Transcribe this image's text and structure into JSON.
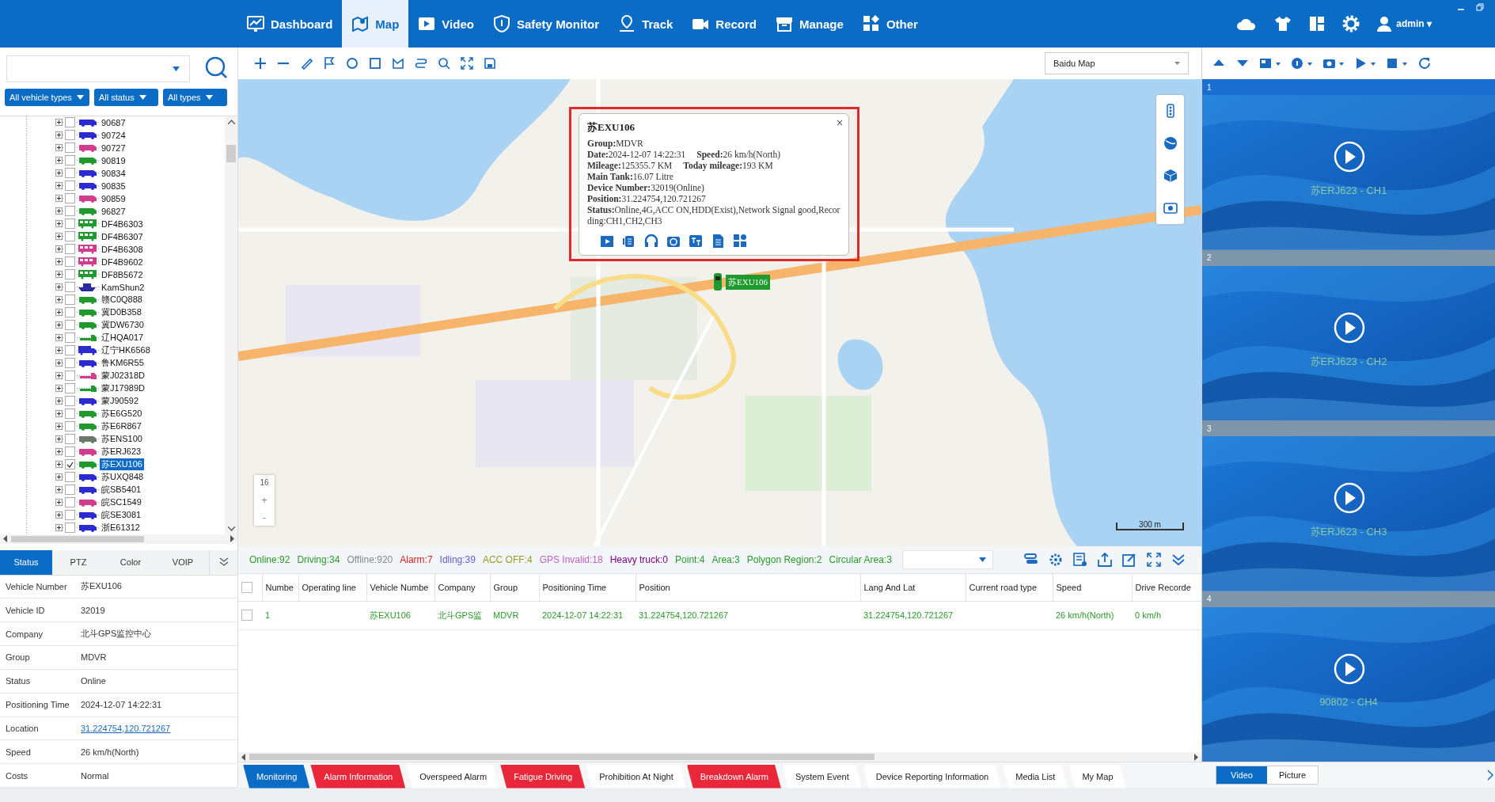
{
  "nav": {
    "items": [
      {
        "label": "Dashboard",
        "selected": false
      },
      {
        "label": "Map",
        "selected": true
      },
      {
        "label": "Video",
        "selected": false
      },
      {
        "label": "Safety Monitor",
        "selected": false
      },
      {
        "label": "Track",
        "selected": false
      },
      {
        "label": "Record",
        "selected": false
      },
      {
        "label": "Manage",
        "selected": false
      },
      {
        "label": "Other",
        "selected": false
      }
    ],
    "user": "admin ▾"
  },
  "vehicle_panel": {
    "filters": [
      "All vehicle types",
      "All status",
      "All types"
    ],
    "tree": [
      {
        "label": "90687",
        "kind": "car",
        "color": "#2b2bd0",
        "checked": false,
        "selected": false
      },
      {
        "label": "90724",
        "kind": "car",
        "color": "#2b2bd0",
        "checked": false,
        "selected": false
      },
      {
        "label": "90727",
        "kind": "car",
        "color": "#d23c8c",
        "checked": false,
        "selected": false
      },
      {
        "label": "90819",
        "kind": "car",
        "color": "#1e9a2e",
        "checked": false,
        "selected": false
      },
      {
        "label": "90834",
        "kind": "car",
        "color": "#2b2bd0",
        "checked": false,
        "selected": false
      },
      {
        "label": "90835",
        "kind": "car",
        "color": "#2b2bd0",
        "checked": false,
        "selected": false
      },
      {
        "label": "90859",
        "kind": "car",
        "color": "#d23c8c",
        "checked": false,
        "selected": false
      },
      {
        "label": "96827",
        "kind": "car",
        "color": "#1e9a2e",
        "checked": false,
        "selected": false
      },
      {
        "label": "DF4B6303",
        "kind": "bus",
        "color": "#1e9a2e",
        "checked": false,
        "selected": false
      },
      {
        "label": "DF4B6307",
        "kind": "bus",
        "color": "#1e9a2e",
        "checked": false,
        "selected": false
      },
      {
        "label": "DF4B6308",
        "kind": "bus",
        "color": "#d23c8c",
        "checked": false,
        "selected": false
      },
      {
        "label": "DF4B9602",
        "kind": "bus",
        "color": "#d23c8c",
        "checked": false,
        "selected": false
      },
      {
        "label": "DF8B5672",
        "kind": "bus",
        "color": "#1e9a2e",
        "checked": false,
        "selected": false
      },
      {
        "label": "KamShun2",
        "kind": "boat",
        "color": "#2a2aa0",
        "checked": false,
        "selected": false
      },
      {
        "label": "赣C0Q888",
        "kind": "car",
        "color": "#1e9a2e",
        "checked": false,
        "selected": false
      },
      {
        "label": "冀D0B358",
        "kind": "car",
        "color": "#1e9a2e",
        "checked": false,
        "selected": false
      },
      {
        "label": "冀DW6730",
        "kind": "car",
        "color": "#1e9a2e",
        "checked": false,
        "selected": false
      },
      {
        "label": "辽HQA017",
        "kind": "pickup",
        "color": "#1e9a2e",
        "checked": false,
        "selected": false
      },
      {
        "label": "辽宁HK6568",
        "kind": "truck",
        "color": "#2b2bd0",
        "checked": false,
        "selected": false
      },
      {
        "label": "鲁KM6R55",
        "kind": "car",
        "color": "#2b2bd0",
        "checked": false,
        "selected": false
      },
      {
        "label": "蒙J02318D",
        "kind": "pickup",
        "color": "#d23c8c",
        "checked": false,
        "selected": false
      },
      {
        "label": "蒙J17989D",
        "kind": "pickup",
        "color": "#1e9a2e",
        "checked": false,
        "selected": false
      },
      {
        "label": "蒙J90592",
        "kind": "car",
        "color": "#2b2bd0",
        "checked": false,
        "selected": false
      },
      {
        "label": "苏E6G520",
        "kind": "car",
        "color": "#1e9a2e",
        "checked": false,
        "selected": false
      },
      {
        "label": "苏E6R867",
        "kind": "car",
        "color": "#1e9a2e",
        "checked": false,
        "selected": false
      },
      {
        "label": "苏ENS100",
        "kind": "car",
        "color": "#6a7a6a",
        "checked": false,
        "selected": false
      },
      {
        "label": "苏ERJ623",
        "kind": "car",
        "color": "#d23c8c",
        "checked": false,
        "selected": false
      },
      {
        "label": "苏EXU106",
        "kind": "car",
        "color": "#1e9a2e",
        "checked": true,
        "selected": true
      },
      {
        "label": "苏UXQ848",
        "kind": "car",
        "color": "#2b2bd0",
        "checked": false,
        "selected": false
      },
      {
        "label": "皖SB5401",
        "kind": "car",
        "color": "#2b2bd0",
        "checked": false,
        "selected": false
      },
      {
        "label": "皖SC1549",
        "kind": "car",
        "color": "#d23c8c",
        "checked": false,
        "selected": false
      },
      {
        "label": "皖SE3081",
        "kind": "car",
        "color": "#2b2bd0",
        "checked": false,
        "selected": false
      },
      {
        "label": "浙E61312",
        "kind": "car",
        "color": "#2b2bd0",
        "checked": false,
        "selected": false
      }
    ],
    "tabs": [
      {
        "label": "Status",
        "selected": true
      },
      {
        "label": "PTZ",
        "selected": false
      },
      {
        "label": "Color",
        "selected": false
      },
      {
        "label": "VOIP",
        "selected": false
      }
    ],
    "details": [
      {
        "label": "Vehicle Number",
        "value": "苏EXU106",
        "kind": "text"
      },
      {
        "label": "Vehicle ID",
        "value": "32019",
        "kind": "text"
      },
      {
        "label": "Company",
        "value": "北斗GPS监控中心",
        "kind": "text"
      },
      {
        "label": "Group",
        "value": "MDVR",
        "kind": "text"
      },
      {
        "label": "Status",
        "value": "Online",
        "kind": "text"
      },
      {
        "label": "Positioning Time",
        "value": "2024-12-07 14:22:31",
        "kind": "text"
      },
      {
        "label": "Location",
        "value": "31.224754,120.721267",
        "kind": "link"
      },
      {
        "label": "Speed",
        "value": "26 km/h(North)",
        "kind": "text"
      },
      {
        "label": "Costs",
        "value": "Normal",
        "kind": "text"
      }
    ]
  },
  "map": {
    "provider": "Baidu Map",
    "popup": {
      "title": "苏EXU106",
      "lines": [
        [
          "**Group:**MDVR"
        ],
        [
          "**Date:**2024-12-07 14:22:31",
          "**Speed:**26 km/h(North)"
        ],
        [
          "**Mileage:**125355.7 KM",
          "**Today mileage:**193 KM"
        ],
        [
          "**Main Tank:**16.07 Litre"
        ],
        [
          "**Device Number:**32019(Online)"
        ],
        [
          "**Position:**31.224754,120.721267"
        ],
        [
          "**Status:**Online,4G,ACC ON,HDD(Exist),Network Signal good,Recording:CH1,CH2,CH3"
        ]
      ],
      "close": "×"
    },
    "marker_label": "苏EXU106",
    "zoom_level": "16",
    "zoom_in": "+",
    "zoom_out": "-",
    "scale": "300 m"
  },
  "status_counts": [
    {
      "label": "Online:92",
      "color": "#2a9a2a"
    },
    {
      "label": "Driving:34",
      "color": "#2a9a2a"
    },
    {
      "label": "Offline:920",
      "color": "#888888"
    },
    {
      "label": "Alarm:7",
      "color": "#e02020"
    },
    {
      "label": "Idling:39",
      "color": "#6a5acd"
    },
    {
      "label": "ACC OFF:4",
      "color": "#9a9a20"
    },
    {
      "label": "GPS Invalid:18",
      "color": "#c060c0"
    },
    {
      "label": "Heavy truck:0",
      "color": "#800080"
    },
    {
      "label": "Point:4",
      "color": "#2a9a2a"
    },
    {
      "label": "Area:3",
      "color": "#2a9a2a"
    },
    {
      "label": "Polygon Region:2",
      "color": "#2a9a2a"
    },
    {
      "label": "Circular Area:3",
      "color": "#2a9a2a"
    }
  ],
  "table": {
    "header_checked": false,
    "columns": [
      "Numbe",
      "Operating line",
      "Vehicle Numbe",
      "Company",
      "Group",
      "Positioning Time",
      "Position",
      "Lang And Lat",
      "Current road type",
      "Speed",
      "Drive Recorde"
    ],
    "rows": [
      {
        "checked": false,
        "cells": [
          "1",
          null,
          "苏EXU106",
          "北斗GPS监",
          "MDVR",
          "2024-12-07 14:22:31",
          "31.224754,120.721267",
          "31.224754,120.721267",
          null,
          "26 km/h(North)",
          "0 km/h"
        ]
      }
    ]
  },
  "bottom_tabs": [
    {
      "label": "Monitoring",
      "kind": "normal",
      "selected": true
    },
    {
      "label": "Alarm Information",
      "kind": "alarm",
      "selected": false
    },
    {
      "label": "Overspeed Alarm",
      "kind": "normal",
      "selected": false
    },
    {
      "label": "Fatigue Driving",
      "kind": "alarm",
      "selected": false
    },
    {
      "label": "Prohibition At Night",
      "kind": "normal",
      "selected": false
    },
    {
      "label": "Breakdown Alarm",
      "kind": "alarm",
      "selected": false
    },
    {
      "label": "System Event",
      "kind": "normal",
      "selected": false
    },
    {
      "label": "Device Reporting Information",
      "kind": "normal",
      "selected": false
    },
    {
      "label": "Media List",
      "kind": "normal",
      "selected": false
    },
    {
      "label": "My Map",
      "kind": "normal",
      "selected": false
    }
  ],
  "video": {
    "cells": [
      {
        "number": "1",
        "label": "苏ERJ623 - CH1",
        "selected": true
      },
      {
        "number": "2",
        "label": "苏ERJ623 - CH2",
        "selected": false
      },
      {
        "number": "3",
        "label": "苏ERJ623 - CH3",
        "selected": false
      },
      {
        "number": "4",
        "label": "90802 - CH4",
        "selected": false
      }
    ],
    "tabs": [
      {
        "label": "Video",
        "selected": true
      },
      {
        "label": "Picture",
        "selected": false
      }
    ]
  }
}
